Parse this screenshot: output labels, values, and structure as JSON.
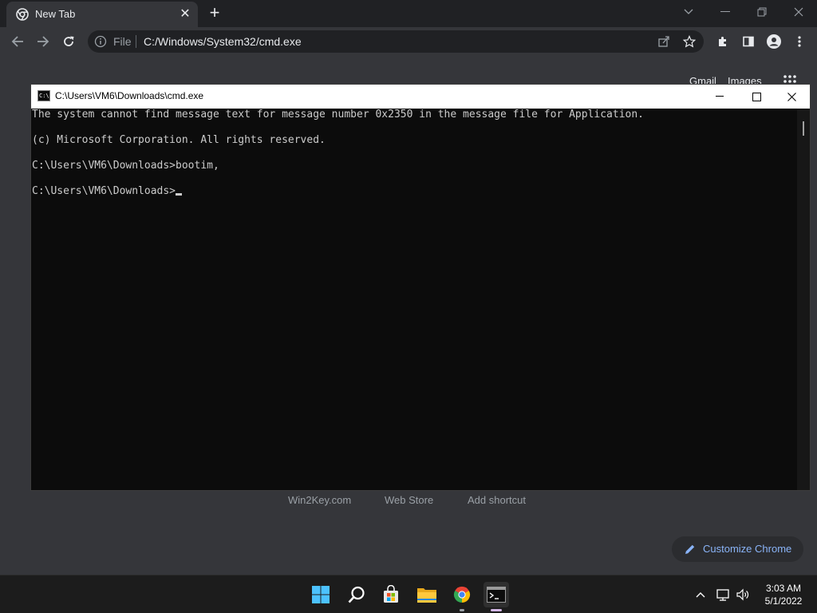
{
  "browser": {
    "tab_title": "New Tab",
    "address_scheme_label": "File",
    "address_url": "C:/Windows/System32/cmd.exe"
  },
  "ntp": {
    "gmail": "Gmail",
    "images": "Images",
    "shortcuts": [
      "Win2Key.com",
      "Web Store",
      "Add shortcut"
    ],
    "customize_label": "Customize Chrome"
  },
  "cmd": {
    "title": "C:\\Users\\VM6\\Downloads\\cmd.exe",
    "icon_text": "C:\\",
    "lines": [
      "The system cannot find message text for message number 0x2350 in the message file for Application.",
      "(c) Microsoft Corporation. All rights reserved.",
      "C:\\Users\\VM6\\Downloads>bootim,",
      "C:\\Users\\VM6\\Downloads>"
    ]
  },
  "taskbar": {
    "time": "3:03 AM",
    "date": "5/1/2022"
  },
  "colors": {
    "accent_blue": "#8ab4f8",
    "terminal_bg": "#0c0c0c",
    "terminal_text": "#cccccc"
  }
}
